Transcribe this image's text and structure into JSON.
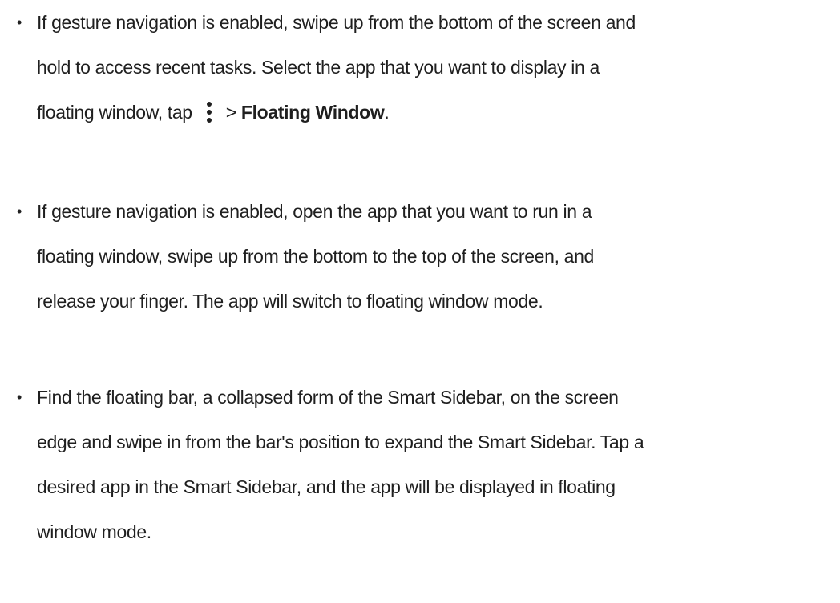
{
  "bullet_symbol": "•",
  "items": [
    {
      "lines": [
        "If gesture navigation is enabled, swipe up from the bottom of the screen and",
        "hold to access recent tasks. Select the app that you want to display in a"
      ],
      "line3_before_icon": "floating window, tap",
      "icon": "more-vertical-icon",
      "line3_arrow": ">",
      "line3_bold": "Floating Window",
      "line3_end": "."
    },
    {
      "lines": [
        "If gesture navigation is enabled, open the app that you want to run in a",
        "floating window, swipe up from the bottom to the top of the screen, and",
        "release your finger. The app will switch to floating window mode."
      ]
    },
    {
      "lines": [
        "Find the floating bar, a collapsed form of the Smart Sidebar, on the screen",
        "edge and swipe in from the bar's position to expand the Smart Sidebar. Tap a",
        "desired app in the Smart Sidebar, and the app will be displayed in floating",
        "window mode."
      ]
    }
  ]
}
